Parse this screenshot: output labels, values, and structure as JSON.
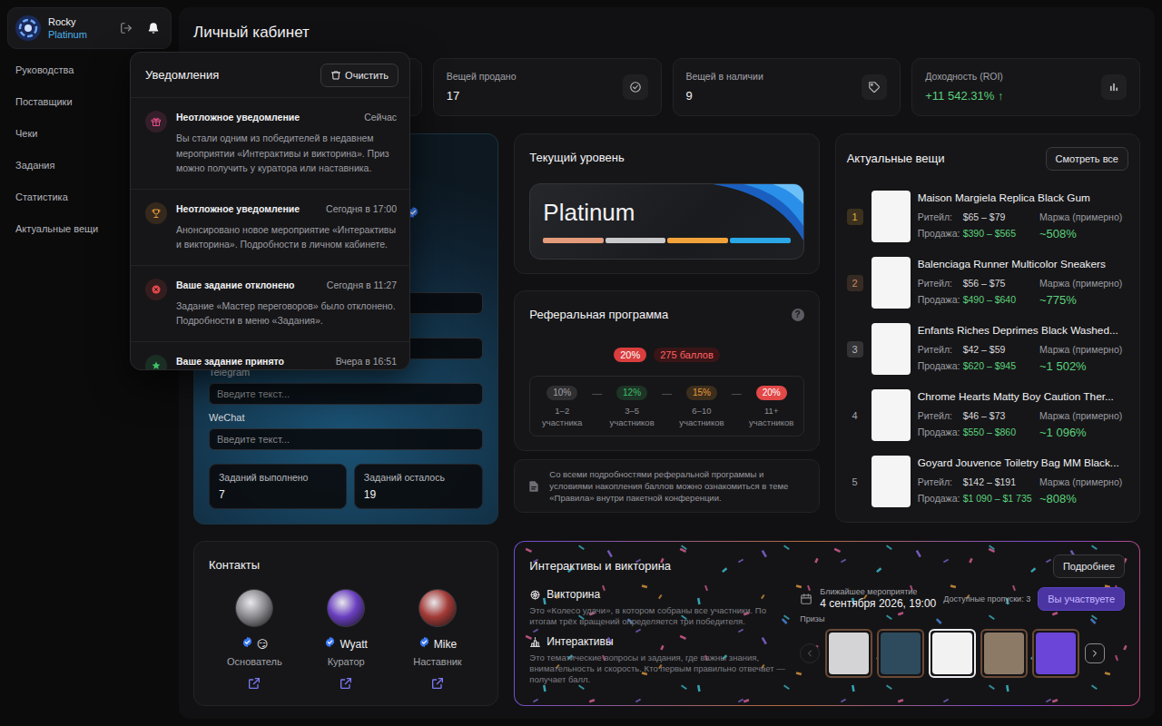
{
  "user": {
    "name": "Rocky",
    "tier": "Platinum"
  },
  "sidebar": {
    "items": [
      "Руководства",
      "Поставщики",
      "Чеки",
      "Задания",
      "Статистика",
      "Актуальные вещи"
    ]
  },
  "page": {
    "title": "Личный кабинет"
  },
  "stats": [
    {
      "kind": "sold",
      "label": "Вещей продано",
      "value": "17"
    },
    {
      "kind": "stock",
      "label": "Вещей в наличии",
      "value": "9"
    },
    {
      "kind": "roi",
      "label": "Доходность (ROI)",
      "value": "+11 542.31% ↑"
    }
  ],
  "notifications": {
    "open": true,
    "title": "Уведомления",
    "clear": "Очистить",
    "items": [
      {
        "kind": "gift",
        "color": "#e0528a",
        "title": "Неотложное уведомление",
        "time": "Сейчас",
        "text": "Вы стали одним из победителей в недавнем мероприятии «Интерактивы и викторина». Приз можно получить у куратора или наставника."
      },
      {
        "kind": "trophy",
        "color": "#e89a3a",
        "title": "Неотложное уведомление",
        "time": "Сегодня в 17:00",
        "text": "Анонсировано новое мероприятие «Интерактивы и викторина». Подробности в личном кабинете."
      },
      {
        "kind": "rejected",
        "color": "#e24848",
        "title": "Ваше задание отклонено",
        "time": "Сегодня в 11:27",
        "text": "Задание «Мастер переговоров» было отклонено. Подробности в меню «Задания»."
      },
      {
        "kind": "accepted",
        "color": "#3fbf6a",
        "title": "Ваше задание принято",
        "time": "Вчера в 16:51"
      }
    ]
  },
  "profile": {
    "verified": true,
    "fields": [
      {
        "label": "Telegram",
        "placeholder": "Введите текст..."
      },
      {
        "label": "WeChat",
        "placeholder": "Введите текст..."
      }
    ],
    "counters": [
      {
        "label": "Заданий выполнено",
        "value": "7"
      },
      {
        "label": "Заданий осталось",
        "value": "19"
      }
    ]
  },
  "level": {
    "title": "Текущий уровень",
    "name": "Platinum",
    "segments": [
      {
        "color": "#e39b7b",
        "level": 1
      },
      {
        "color": "#c9c9cc",
        "level": 1
      },
      {
        "color": "#f2a23a",
        "level": 1
      },
      {
        "color": "#2aa7e6",
        "level": 1
      }
    ]
  },
  "referral": {
    "title": "Реферальная программа",
    "help": "?",
    "rate": "20%",
    "points": "275 баллов",
    "separator": "—",
    "tiers": [
      {
        "rate": "10%",
        "range": "1–2 участника",
        "color": "#a0a0a6",
        "selected": false
      },
      {
        "rate": "12%",
        "range": "3–5 участников",
        "color": "#3fbf6a",
        "selected": false
      },
      {
        "rate": "15%",
        "range": "6–10 участников",
        "color": "#e89a3a",
        "selected": false
      },
      {
        "rate": "20%",
        "range": "11+ участников",
        "color": "#e24848",
        "selected": true
      }
    ],
    "note": "Со всеми подробностями реферальной программы и условиями накопления баллов можно ознакомиться в теме «Правила» внутри пакетной конференции."
  },
  "hot": {
    "title": "Актуальные вещи",
    "button": "Смотреть все",
    "retail_label": "Ритейл:",
    "sale_label": "Продажа:",
    "margin_label": "Маржа (примерно)",
    "items": [
      {
        "rank": "1",
        "kind": "medal",
        "color": "#e2ab3c",
        "name": "Maison Margiela Replica Black Gum",
        "retail": "$65 – $79",
        "sale": "$390 – $565",
        "margin": "~508%"
      },
      {
        "rank": "2",
        "kind": "medal",
        "color": "#c98a5e",
        "name": "Balenciaga Runner Multicolor Sneakers",
        "retail": "$56 – $75",
        "sale": "$490 – $640",
        "margin": "~775%"
      },
      {
        "rank": "3",
        "kind": "medal",
        "color": "#b8b8be",
        "name": "Enfants Riches Deprimes Black Washed...",
        "retail": "$42 – $59",
        "sale": "$620 – $945",
        "margin": "~1 502%"
      },
      {
        "rank": "4",
        "kind": "plain",
        "color": "#a2a2a8",
        "name": "Chrome Hearts Matty Boy Caution Ther...",
        "retail": "$46 – $73",
        "sale": "$550 – $860",
        "margin": "~1 096%"
      },
      {
        "rank": "5",
        "kind": "plain",
        "color": "#a2a2a8",
        "name": "Goyard Jouvence Toiletry Bag MM Black...",
        "retail": "$142 – $191",
        "sale": "$1 090 – $1 735",
        "margin": "~808%"
      }
    ]
  },
  "contacts": {
    "title": "Контакты",
    "people": [
      {
        "name": "😏",
        "role": "Основатель",
        "verified": true,
        "color": "#8c8c90"
      },
      {
        "name": "Wyatt",
        "role": "Куратор",
        "verified": true,
        "color": "#6a3fc0"
      },
      {
        "name": "Mike",
        "role": "Наставник",
        "verified": true,
        "color": "#a33a36"
      }
    ]
  },
  "events": {
    "title": "Интерактивы и викторина",
    "more": "Подробнее",
    "formats": [
      {
        "kind": "wheel",
        "title": "Викторина",
        "text": "Это «Колесо удачи», в котором собраны все участники. По итогам трёх вращений определяется три победителя."
      },
      {
        "kind": "quiz",
        "title": "Интерактивы",
        "text": "Это тематические вопросы и задания, где важны знания, внимательность и скорость. Кто первым правильно отвечает — получает балл."
      }
    ],
    "next_label": "Ближайшее мероприятие",
    "next_date": "4 сентября 2026, 19:00",
    "passes": "Доступные пропуски: 3",
    "join": "Вы участвуете",
    "joined": true,
    "prizes_label": "Призы",
    "can_prev": false,
    "can_next": true,
    "prizes": [
      {
        "color": "#d4d4d6",
        "selected": false
      },
      {
        "color": "#2d4b5c",
        "selected": false
      },
      {
        "color": "#f2f2f2",
        "selected": true
      },
      {
        "color": "#8d7a66",
        "selected": false
      },
      {
        "color": "#6b45d8",
        "selected": false
      }
    ]
  }
}
